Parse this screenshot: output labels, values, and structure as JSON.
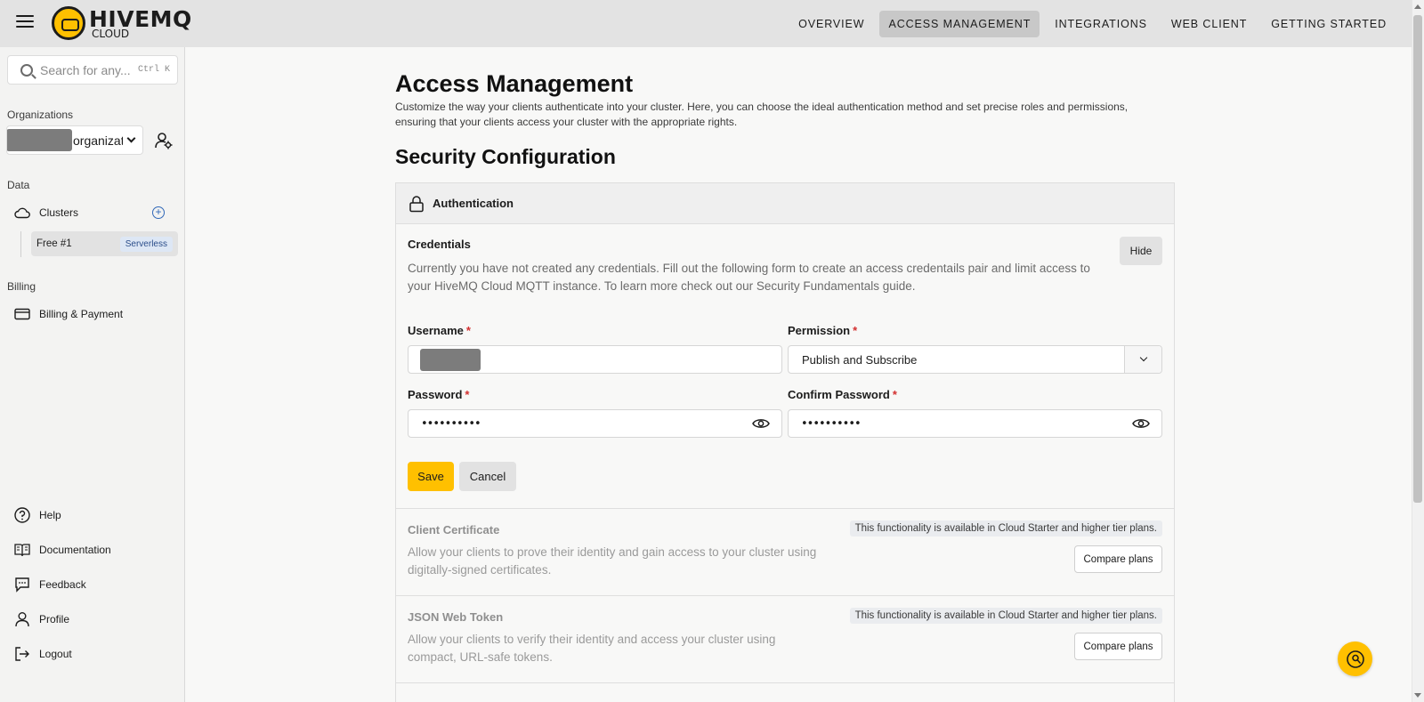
{
  "app": {
    "logo_main": "HIVEMQ",
    "logo_sub": "CLOUD"
  },
  "nav": {
    "items": [
      {
        "label": "OVERVIEW",
        "active": false
      },
      {
        "label": "ACCESS MANAGEMENT",
        "active": true
      },
      {
        "label": "INTEGRATIONS",
        "active": false
      },
      {
        "label": "WEB CLIENT",
        "active": false
      },
      {
        "label": "GETTING STARTED",
        "active": false
      }
    ]
  },
  "sidebar": {
    "search": {
      "placeholder": "Search for any...",
      "shortcut": "Ctrl K"
    },
    "organizations_label": "Organizations",
    "org_select_text": "organizat",
    "data_label": "Data",
    "clusters_label": "Clusters",
    "cluster": {
      "name": "Free #1",
      "badge": "Serverless"
    },
    "billing_label": "Billing",
    "billing_item": "Billing & Payment",
    "bottom_items": [
      {
        "label": "Help",
        "icon": "help-icon"
      },
      {
        "label": "Documentation",
        "icon": "book-icon"
      },
      {
        "label": "Feedback",
        "icon": "feedback-icon"
      },
      {
        "label": "Profile",
        "icon": "profile-icon"
      },
      {
        "label": "Logout",
        "icon": "logout-icon"
      }
    ]
  },
  "main": {
    "title": "Access Management",
    "description": "Customize the way your clients authenticate into your cluster. Here, you can choose the ideal authentication method and set precise roles and permissions, ensuring that your clients access your cluster with the appropriate rights.",
    "section_title": "Security Configuration",
    "card_title": "Authentication",
    "credentials": {
      "title": "Credentials",
      "description": "Currently you have not created any credentials. Fill out the following form to create an access credentails pair and limit access to your HiveMQ Cloud MQTT instance. To learn more check out our Security Fundamentals guide.",
      "hide_label": "Hide",
      "username_label": "Username",
      "permission_label": "Permission",
      "permission_value": "Publish and Subscribe",
      "password_label": "Password",
      "password_value": "••••••••••",
      "confirm_label": "Confirm Password",
      "confirm_value": "••••••••••",
      "required_mark": "*",
      "save_label": "Save",
      "cancel_label": "Cancel"
    },
    "client_certificate": {
      "title": "Client Certificate",
      "description": "Allow your clients to prove their identity and gain access to your cluster using digitally-signed certificates.",
      "tier_note": "This functionality is available in Cloud Starter and higher tier plans.",
      "button": "Compare plans"
    },
    "jwt": {
      "title": "JSON Web Token",
      "description": "Allow your clients to verify their identity and access your cluster using compact, URL-safe tokens.",
      "tier_note": "This functionality is available in Cloud Starter and higher tier plans.",
      "button": "Compare plans"
    }
  },
  "colors": {
    "accent": "#ffc000",
    "active_nav_bg": "#c8c8c8",
    "required": "#d32f2f"
  }
}
